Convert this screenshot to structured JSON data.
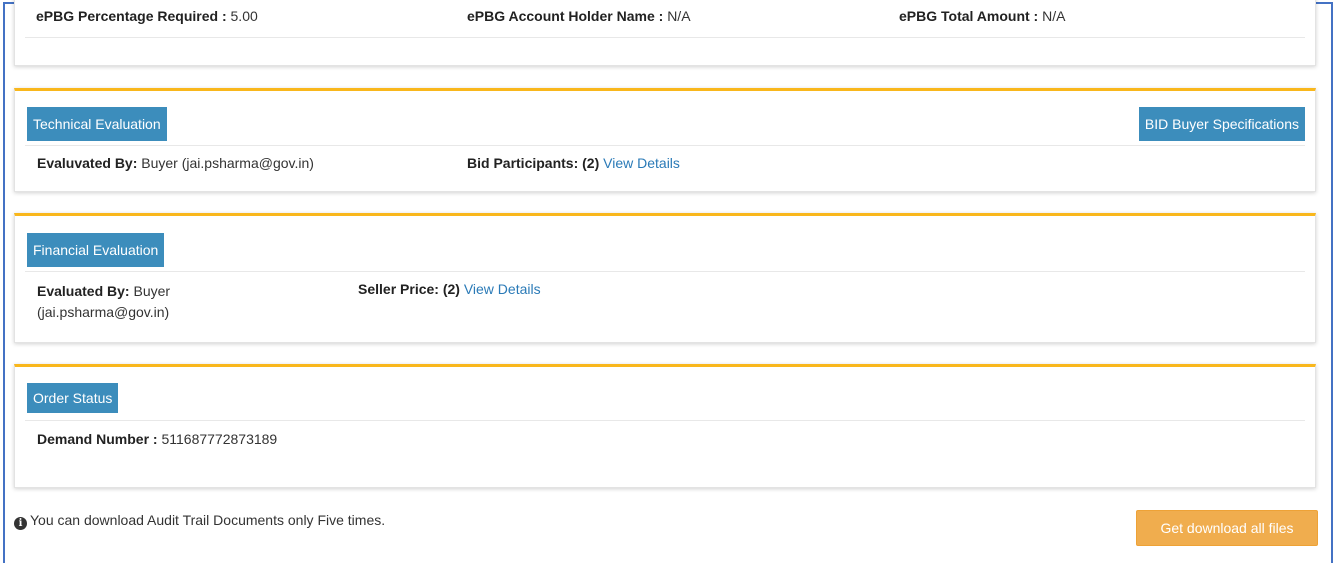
{
  "epbg": {
    "percentage_label": "ePBG Percentage Required :",
    "percentage_value": "5.00",
    "holder_label": "ePBG Account Holder Name :",
    "holder_value": "N/A",
    "total_label": "ePBG Total Amount :",
    "total_value": "N/A"
  },
  "technical": {
    "title": "Technical Evaluation",
    "specs_button": "BID Buyer Specifications",
    "evaluated_label": "Evaluvated By:",
    "evaluated_value": "Buyer (jai.psharma@gov.in)",
    "participants_label": "Bid Participants: (2)",
    "participants_link": "View Details"
  },
  "financial": {
    "title": "Financial Evaluation",
    "evaluated_label": "Evaluated By:",
    "evaluated_value_1": "Buyer",
    "evaluated_value_2": "(jai.psharma@gov.in)",
    "seller_label": "Seller Price: (2)",
    "seller_link": "View Details"
  },
  "order": {
    "title": "Order Status",
    "demand_label": "Demand Number :",
    "demand_value": "511687772873189"
  },
  "footer": {
    "note": "You can download Audit Trail Documents only Five times.",
    "info_icon": "info-circle-icon",
    "download_button": "Get download all files"
  },
  "colors": {
    "header_blue": "#3c8dbc",
    "accent_gold": "#f9b71c",
    "link_blue": "#2a7ab7",
    "button_orange": "#f0ad4e"
  }
}
